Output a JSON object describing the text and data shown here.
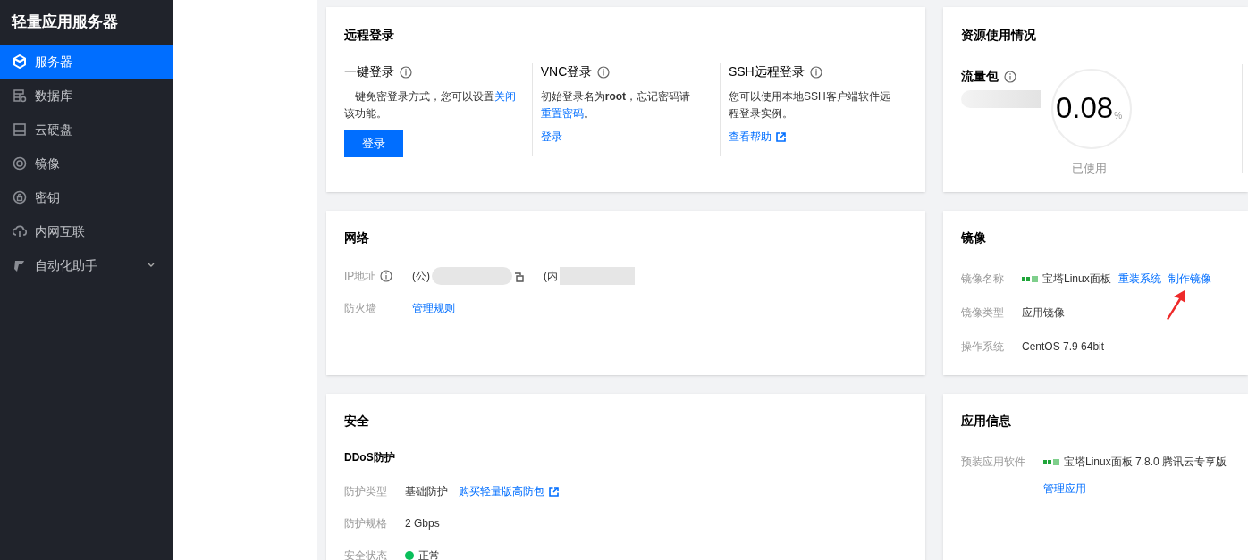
{
  "sidebar": {
    "title": "轻量应用服务器",
    "items": [
      {
        "label": "服务器",
        "selected": true
      },
      {
        "label": "数据库",
        "selected": false
      },
      {
        "label": "云硬盘",
        "selected": false
      },
      {
        "label": "镜像",
        "selected": false
      },
      {
        "label": "密钥",
        "selected": false
      },
      {
        "label": "内网互联",
        "selected": false
      },
      {
        "label": "自动化助手",
        "selected": false,
        "expandable": true
      }
    ]
  },
  "remote_login": {
    "title": "远程登录",
    "columns": [
      {
        "title": "一键登录",
        "desc": "一键免密登录方式，您可以设置",
        "desc_link": "关闭",
        "desc_tail": "该功能。",
        "action": "登录",
        "kind": "button"
      },
      {
        "title": "VNC登录",
        "desc": "初始登录名为**root**，忘记密码请",
        "desc_link": "重置密码",
        "desc_tail": "。",
        "action": "登录",
        "kind": "link"
      },
      {
        "title": "SSH远程登录",
        "desc": "您可以使用本地SSH客户端软件远程登录实例。",
        "action": "查看帮助",
        "kind": "external"
      }
    ]
  },
  "resources": {
    "title": "资源使用情况",
    "traffic_label": "流量包",
    "gauge_value": "0.08",
    "gauge_unit": "%",
    "level": 0.0008,
    "gauge_caption": "已使用"
  },
  "network": {
    "title": "网络",
    "ip_label": "IP地址",
    "public_prefix": "(公)",
    "private_prefix": "(内",
    "firewall_label": "防火墙",
    "firewall_link": "管理规则"
  },
  "image": {
    "title": "镜像",
    "rows": [
      {
        "label": "镜像名称",
        "value": "宝塔Linux面板",
        "logo": true,
        "links": [
          "重装系统",
          "制作镜像"
        ]
      },
      {
        "label": "镜像类型",
        "value": "应用镜像"
      },
      {
        "label": "操作系统",
        "value": "CentOS 7.9 64bit"
      }
    ]
  },
  "security": {
    "title": "安全",
    "subtitle": "DDoS防护",
    "rows": [
      {
        "label": "防护类型",
        "value": "基础防护",
        "link": "购买轻量版高防包",
        "kind": "text"
      },
      {
        "label": "防护规格",
        "value": "2 Gbps",
        "kind": "text"
      },
      {
        "label": "安全状态",
        "value": "正常",
        "kind": "status",
        "color": "#0abf5b"
      }
    ]
  },
  "app_info": {
    "title": "应用信息",
    "label": "预装应用软件",
    "logo": true,
    "value": "宝塔Linux面板 7.8.0 腾讯云专享版",
    "link": "管理应用"
  }
}
